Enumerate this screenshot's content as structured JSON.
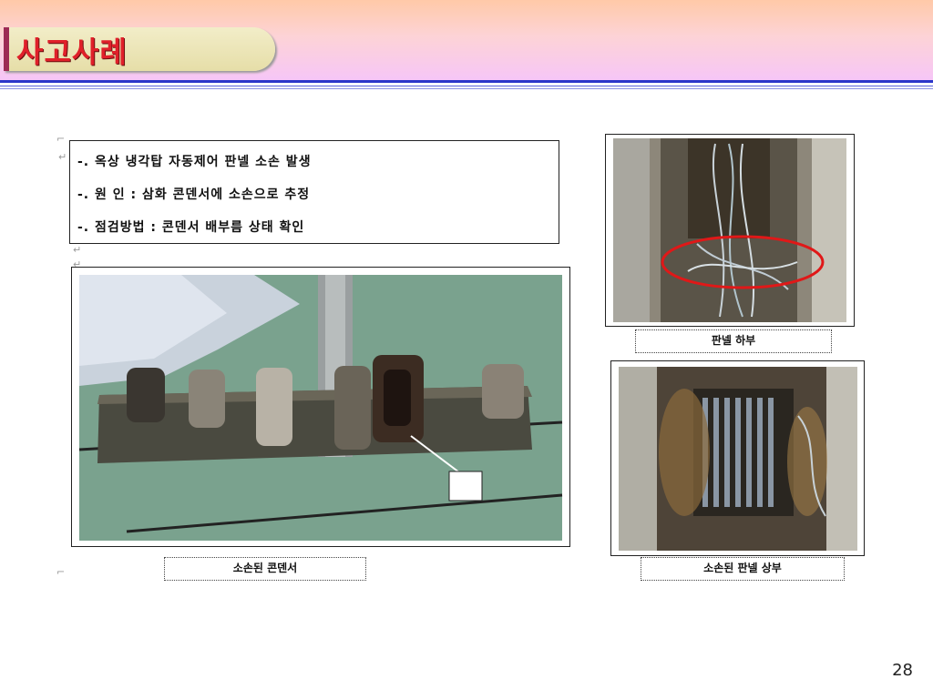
{
  "slide": {
    "title": "사고사례",
    "page_number": "28"
  },
  "description": {
    "lines": [
      "-. 옥상 냉각탑 자동제어 판넬 소손 발생",
      "-. 원 인 : 삼화 콘덴서에 소손으로 추정",
      "-. 점검방법 : 콘덴서 배부름 상태 확인"
    ]
  },
  "photos": {
    "capacitor": {
      "caption": "소손된 콘덴서"
    },
    "panel_bottom": {
      "caption": "판넬 하부"
    },
    "panel_top": {
      "caption": "소손된 판넬 상부"
    }
  },
  "colors": {
    "title_text": "#e0202a",
    "rule_blue": "#2b36c9",
    "highlight_ellipse": "#e01818"
  }
}
